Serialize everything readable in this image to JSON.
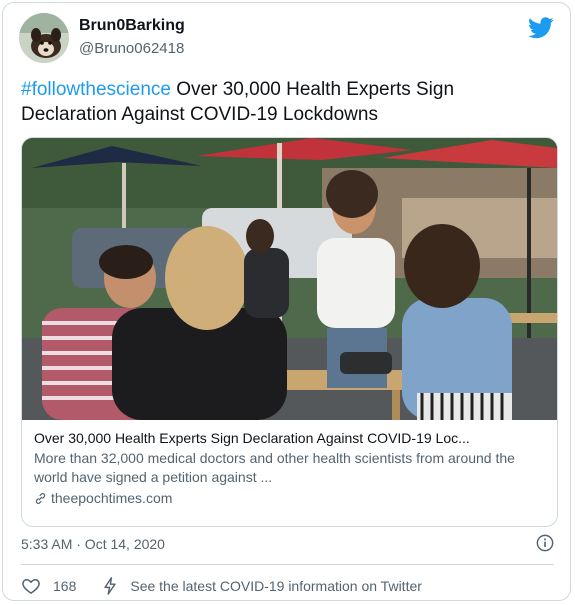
{
  "user": {
    "display_name": "Brun0Barking",
    "handle": "@Bruno062418"
  },
  "tweet": {
    "hashtag": "#followthescience",
    "text": " Over 30,000 Health Experts Sign Declaration Against COVID-19 Lockdowns"
  },
  "card": {
    "title": "Over 30,000 Health Experts Sign Declaration Against COVID-19 Loc...",
    "description": "More than 32,000 medical doctors and other health scientists from around the world have signed a petition against ...",
    "domain": "theepochtimes.com"
  },
  "meta": {
    "timestamp": "5:33 AM · Oct 14, 2020",
    "like_count": "168",
    "covid_link": "See the latest COVID-19 information on Twitter"
  },
  "icons": {
    "brand": "twitter-bird-icon",
    "link": "link-icon",
    "info": "info-icon",
    "like": "heart-icon",
    "covid": "lightning-bolt-icon"
  },
  "colors": {
    "accent": "#1d9bf0",
    "secondary_text": "#536471",
    "border": "#cfd9de"
  }
}
